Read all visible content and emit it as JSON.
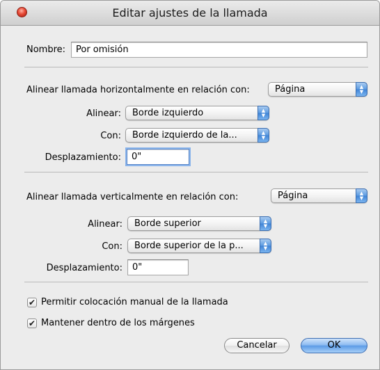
{
  "window": {
    "title": "Editar ajustes de la llamada"
  },
  "name_field": {
    "label": "Nombre:",
    "value": "Por omisión"
  },
  "horizontal": {
    "heading": "Alinear llamada horizontalmente en relación con:",
    "relative_to": "Página",
    "align_label": "Alinear:",
    "align_value": "Borde izquierdo",
    "with_label": "Con:",
    "with_value": "Borde izquierdo de la...",
    "offset_label": "Desplazamiento:",
    "offset_value": "0\""
  },
  "vertical": {
    "heading": "Alinear llamada verticalmente en relación con:",
    "relative_to": "Página",
    "align_label": "Alinear:",
    "align_value": "Borde superior",
    "with_label": "Con:",
    "with_value": "Borde superior de la p...",
    "offset_label": "Desplazamiento:",
    "offset_value": "0\""
  },
  "options": [
    {
      "label": "Permitir colocación manual de la llamada",
      "checked": true
    },
    {
      "label": "Mantener dentro de los márgenes",
      "checked": true
    }
  ],
  "buttons": {
    "cancel": "Cancelar",
    "ok": "OK"
  },
  "icons": {
    "check": "✔",
    "up": "▲",
    "down": "▼"
  }
}
